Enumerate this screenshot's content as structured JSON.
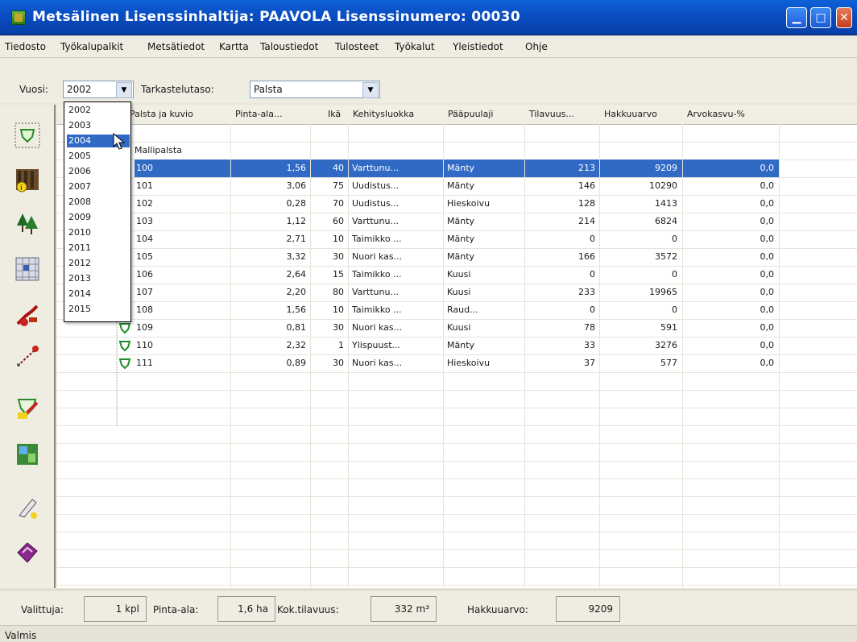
{
  "title": "Metsälinen   Lisenssinhaltija: PAAVOLA   Lisenssinumero: 00030",
  "menu": [
    "Tiedosto",
    "Työkalupalkit",
    "Metsätiedot",
    "Kartta",
    "Taloustiedot",
    "Tulosteet",
    "Työkalut",
    "Yleistiedot",
    "Ohje"
  ],
  "toolbar": {
    "vuosi_label": "Vuosi:",
    "vuosi_value": "2002",
    "tarkastelu_label": "Tarkastelutaso:",
    "tarkastelu_value": "Palsta"
  },
  "dropdown": {
    "items": [
      "2002",
      "2003",
      "2004",
      "2005",
      "2006",
      "2007",
      "2008",
      "2009",
      "2010",
      "2011",
      "2012",
      "2013",
      "2014",
      "2015"
    ],
    "highlighted": "2004"
  },
  "columns": [
    "Palsta ja kuvio",
    "Pinta-ala...",
    "Ikä",
    "Kehitysluokka",
    "Pääpuulaji",
    "Tilavuus...",
    "Hakkuuarvo",
    "Arvokasvu-%"
  ],
  "group_label": "Mallipalsta",
  "rows": [
    {
      "kuvio": "100",
      "ala": "1,56",
      "ika": "40",
      "luokka": "Varttunu...",
      "puulaji": "Mänty",
      "tilavuus": "213",
      "hakkuu": "9209",
      "arvo": "0,0"
    },
    {
      "kuvio": "101",
      "ala": "3,06",
      "ika": "75",
      "luokka": "Uudistus...",
      "puulaji": "Mänty",
      "tilavuus": "146",
      "hakkuu": "10290",
      "arvo": "0,0"
    },
    {
      "kuvio": "102",
      "ala": "0,28",
      "ika": "70",
      "luokka": "Uudistus...",
      "puulaji": "Hieskoivu",
      "tilavuus": "128",
      "hakkuu": "1413",
      "arvo": "0,0"
    },
    {
      "kuvio": "103",
      "ala": "1,12",
      "ika": "60",
      "luokka": "Varttunu...",
      "puulaji": "Mänty",
      "tilavuus": "214",
      "hakkuu": "6824",
      "arvo": "0,0"
    },
    {
      "kuvio": "104",
      "ala": "2,71",
      "ika": "10",
      "luokka": "Taimikko ...",
      "puulaji": "Mänty",
      "tilavuus": "0",
      "hakkuu": "0",
      "arvo": "0,0"
    },
    {
      "kuvio": "105",
      "ala": "3,32",
      "ika": "30",
      "luokka": "Nuori kas...",
      "puulaji": "Mänty",
      "tilavuus": "166",
      "hakkuu": "3572",
      "arvo": "0,0"
    },
    {
      "kuvio": "106",
      "ala": "2,64",
      "ika": "15",
      "luokka": "Taimikko ...",
      "puulaji": "Kuusi",
      "tilavuus": "0",
      "hakkuu": "0",
      "arvo": "0,0"
    },
    {
      "kuvio": "107",
      "ala": "2,20",
      "ika": "80",
      "luokka": "Varttunu...",
      "puulaji": "Kuusi",
      "tilavuus": "233",
      "hakkuu": "19965",
      "arvo": "0,0"
    },
    {
      "kuvio": "108",
      "ala": "1,56",
      "ika": "10",
      "luokka": "Taimikko ...",
      "puulaji": "Raud...",
      "tilavuus": "0",
      "hakkuu": "0",
      "arvo": "0,0"
    },
    {
      "kuvio": "109",
      "ala": "0,81",
      "ika": "30",
      "luokka": "Nuori kas...",
      "puulaji": "Kuusi",
      "tilavuus": "78",
      "hakkuu": "591",
      "arvo": "0,0"
    },
    {
      "kuvio": "110",
      "ala": "2,32",
      "ika": "1",
      "luokka": "Ylispuust...",
      "puulaji": "Mänty",
      "tilavuus": "33",
      "hakkuu": "3276",
      "arvo": "0,0"
    },
    {
      "kuvio": "111",
      "ala": "0,89",
      "ika": "30",
      "luokka": "Nuori kas...",
      "puulaji": "Hieskoivu",
      "tilavuus": "37",
      "hakkuu": "577",
      "arvo": "0,0"
    }
  ],
  "selected_row": "100",
  "status": {
    "valittuja_label": "Valittuja:",
    "valittuja_value": "1 kpl",
    "pinta_label": "Pinta-ala:",
    "pinta_value": "1,6 ha",
    "tilavuus_label": "Kok.tilavuus:",
    "tilavuus_value": "332 m³",
    "hakkuu_label": "Hakkuuarvo:",
    "hakkuu_value": "9209",
    "bottom": "Valmis"
  },
  "colors": {
    "selection": "#316ac5",
    "title_bar": "#0a4fc4"
  }
}
